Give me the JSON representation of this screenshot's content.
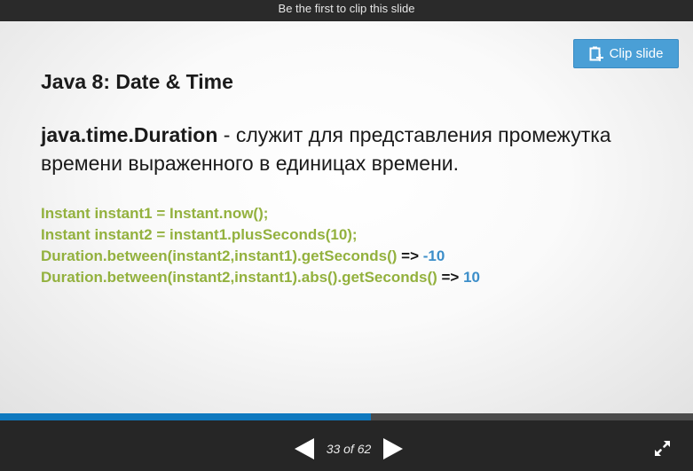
{
  "topbar": {
    "text": "Be the first to clip this slide"
  },
  "clip_button": {
    "label": "Clip slide",
    "icon": "clip-icon",
    "color": "#4a9fd6"
  },
  "slide": {
    "title": "Java 8: Date & Time",
    "description": {
      "term": "java.time.Duration",
      "text": " - служит для представления промежутка времени выраженного в единицах времени."
    },
    "code": [
      {
        "code": "Instant instant1 = Instant.now();"
      },
      {
        "code": "Instant instant2 = instant1.plusSeconds(10);"
      },
      {
        "code": "Duration.between(instant2,instant1).getSeconds()",
        "arrow": "=>",
        "result": "-10"
      },
      {
        "code": "Duration.between(instant2,instant1).abs().getSeconds()",
        "arrow": "=>",
        "result": "10"
      }
    ],
    "colors": {
      "code": "#93b13e",
      "result": "#3c8ec9"
    }
  },
  "progress": {
    "fraction": 0.535,
    "color": "#0f79bf"
  },
  "navigation": {
    "current": "33",
    "total": "62",
    "counter_text": "33 of 62",
    "prev_icon": "triangle-left-icon",
    "next_icon": "triangle-right-icon"
  },
  "fullscreen": {
    "icon": "expand-icon"
  }
}
